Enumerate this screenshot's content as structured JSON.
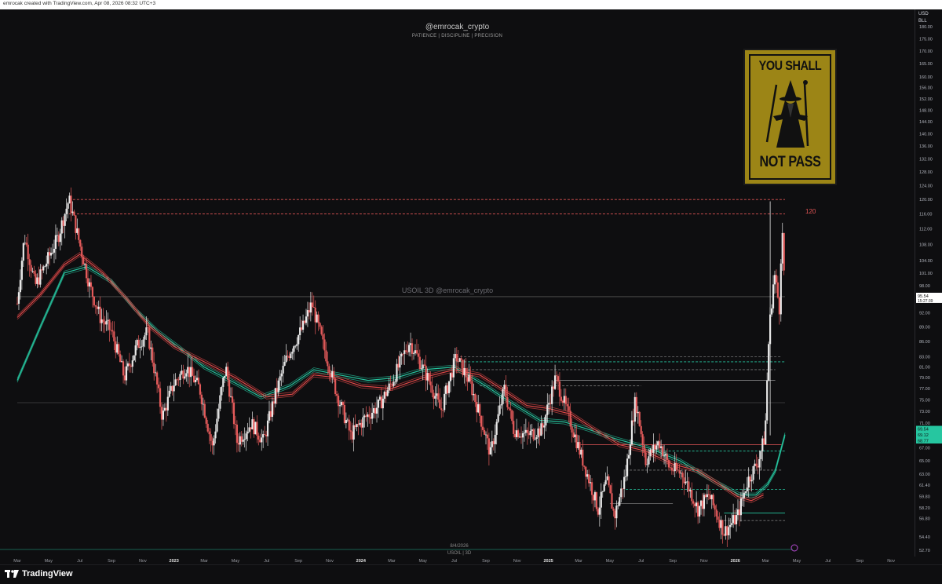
{
  "header": {
    "created_text": "emrocak created with TradingView.com, Apr 08, 2026 08:32 UTC+3",
    "handle": "@emrocak_crypto",
    "subtitle": "PATIENCE  |  DISCIPLINE  |  PRECISION"
  },
  "watermark": "USOIL 3D  @emrocak_crypto",
  "poster": {
    "line1": "YOU SHALL",
    "line2": "NOT PASS",
    "icon": "wizard-silhouette-icon"
  },
  "price_axis": {
    "currency": "USD",
    "unit": "BLL"
  },
  "level_label": "120",
  "bottom_note": {
    "date": "8/4/2026",
    "symbol": "USOIL | 3D"
  },
  "footer": {
    "brand": "TradingView",
    "logo": "tradingview-logo-icon"
  },
  "colors": {
    "up": "#e8e8e8",
    "down": "#e35a5a",
    "ema_fast": "#e04848",
    "ema_slow": "#26c6a0",
    "level": "#e25555",
    "background": "#0e0e10"
  },
  "chart_data": {
    "type": "candlestick",
    "symbol": "USOIL",
    "timeframe": "3D",
    "ylim": [
      52.7,
      182
    ],
    "x_range": [
      "2022-03-01",
      "2026-11-30"
    ],
    "y_ticks": [
      52.7,
      54.4,
      56.8,
      58.2,
      59.8,
      61.4,
      63.0,
      65.0,
      67.0,
      69.0,
      71.0,
      73.0,
      75.0,
      77.0,
      79.0,
      81.0,
      83.0,
      86.0,
      89.0,
      92.0,
      95.0,
      98.0,
      101.0,
      104.0,
      108.0,
      112.0,
      116.0,
      120.0,
      124.0,
      128.0,
      132.0,
      136.0,
      140.0,
      144.0,
      148.0,
      152.0,
      156.0,
      160.0,
      165.0,
      170.0,
      175.0,
      180.0
    ],
    "x_ticks": [
      {
        "label": "Mar",
        "date": "2022-03-01"
      },
      {
        "label": "May",
        "date": "2022-05-01"
      },
      {
        "label": "Jul",
        "date": "2022-07-01"
      },
      {
        "label": "Sep",
        "date": "2022-09-01"
      },
      {
        "label": "Nov",
        "date": "2022-11-01"
      },
      {
        "label": "2023",
        "date": "2023-01-01"
      },
      {
        "label": "Mar",
        "date": "2023-03-01"
      },
      {
        "label": "May",
        "date": "2023-05-01"
      },
      {
        "label": "Jul",
        "date": "2023-07-01"
      },
      {
        "label": "Sep",
        "date": "2023-09-01"
      },
      {
        "label": "Nov",
        "date": "2023-11-01"
      },
      {
        "label": "2024",
        "date": "2024-01-01"
      },
      {
        "label": "Mar",
        "date": "2024-03-01"
      },
      {
        "label": "May",
        "date": "2024-05-01"
      },
      {
        "label": "Jul",
        "date": "2024-07-01"
      },
      {
        "label": "Sep",
        "date": "2024-09-01"
      },
      {
        "label": "Nov",
        "date": "2024-11-01"
      },
      {
        "label": "2025",
        "date": "2025-01-01"
      },
      {
        "label": "Mar",
        "date": "2025-03-01"
      },
      {
        "label": "May",
        "date": "2025-05-01"
      },
      {
        "label": "Jul",
        "date": "2025-07-01"
      },
      {
        "label": "Sep",
        "date": "2025-09-01"
      },
      {
        "label": "Nov",
        "date": "2025-11-01"
      },
      {
        "label": "2026",
        "date": "2026-01-01"
      },
      {
        "label": "Mar",
        "date": "2026-03-01"
      },
      {
        "label": "May",
        "date": "2026-05-01"
      },
      {
        "label": "Jul",
        "date": "2026-07-01"
      },
      {
        "label": "Sep",
        "date": "2026-09-01"
      },
      {
        "label": "Nov",
        "date": "2026-11-01"
      }
    ],
    "price_path": [
      [
        "2022-03-01",
        94
      ],
      [
        "2022-03-15",
        110
      ],
      [
        "2022-04-05",
        98
      ],
      [
        "2022-04-25",
        103
      ],
      [
        "2022-05-20",
        110
      ],
      [
        "2022-06-10",
        120
      ],
      [
        "2022-07-01",
        108
      ],
      [
        "2022-07-20",
        98
      ],
      [
        "2022-08-10",
        91
      ],
      [
        "2022-09-01",
        88
      ],
      [
        "2022-09-26",
        79
      ],
      [
        "2022-10-20",
        85
      ],
      [
        "2022-11-10",
        88
      ],
      [
        "2022-12-09",
        72
      ],
      [
        "2023-01-01",
        78
      ],
      [
        "2023-01-25",
        81
      ],
      [
        "2023-02-20",
        77
      ],
      [
        "2023-03-17",
        67
      ],
      [
        "2023-04-12",
        81
      ],
      [
        "2023-05-04",
        68
      ],
      [
        "2023-06-01",
        71
      ],
      [
        "2023-06-25",
        68
      ],
      [
        "2023-07-15",
        75
      ],
      [
        "2023-08-10",
        83
      ],
      [
        "2023-09-10",
        89
      ],
      [
        "2023-09-27",
        94
      ],
      [
        "2023-10-20",
        85
      ],
      [
        "2023-11-15",
        76
      ],
      [
        "2023-12-12",
        69
      ],
      [
        "2024-01-10",
        72
      ],
      [
        "2024-02-05",
        74
      ],
      [
        "2024-03-01",
        78
      ],
      [
        "2024-04-05",
        86
      ],
      [
        "2024-04-25",
        82
      ],
      [
        "2024-05-20",
        77
      ],
      [
        "2024-06-05",
        73
      ],
      [
        "2024-07-05",
        83
      ],
      [
        "2024-08-01",
        78
      ],
      [
        "2024-09-10",
        66
      ],
      [
        "2024-10-07",
        77
      ],
      [
        "2024-10-25",
        70
      ],
      [
        "2024-11-20",
        69
      ],
      [
        "2024-12-20",
        70
      ],
      [
        "2025-01-15",
        79
      ],
      [
        "2025-02-10",
        72
      ],
      [
        "2025-03-05",
        66
      ],
      [
        "2025-04-08",
        58
      ],
      [
        "2025-04-25",
        62
      ],
      [
        "2025-05-10",
        57
      ],
      [
        "2025-06-01",
        63
      ],
      [
        "2025-06-20",
        75
      ],
      [
        "2025-07-10",
        65
      ],
      [
        "2025-08-05",
        68
      ],
      [
        "2025-08-25",
        64
      ],
      [
        "2025-09-20",
        63
      ],
      [
        "2025-10-20",
        58
      ],
      [
        "2025-11-10",
        60
      ],
      [
        "2025-12-10",
        55
      ],
      [
        "2026-01-05",
        57
      ],
      [
        "2026-01-25",
        62
      ],
      [
        "2026-02-15",
        65
      ],
      [
        "2026-02-28",
        69
      ],
      [
        "2026-03-08",
        88
      ],
      [
        "2026-03-18",
        101
      ],
      [
        "2026-03-28",
        93
      ],
      [
        "2026-04-02",
        113
      ],
      [
        "2026-04-08",
        95.54
      ]
    ],
    "ema_fast": [
      [
        "2022-03-01",
        91
      ],
      [
        "2022-04-15",
        96
      ],
      [
        "2022-06-01",
        103
      ],
      [
        "2022-07-01",
        105.5
      ],
      [
        "2022-08-15",
        101
      ],
      [
        "2022-10-01",
        95
      ],
      [
        "2022-11-15",
        89
      ],
      [
        "2023-01-01",
        85
      ],
      [
        "2023-03-01",
        82
      ],
      [
        "2023-05-01",
        79
      ],
      [
        "2023-07-01",
        75.5
      ],
      [
        "2023-08-20",
        76
      ],
      [
        "2023-10-01",
        79.5
      ],
      [
        "2023-11-15",
        79
      ],
      [
        "2024-01-01",
        77.5
      ],
      [
        "2024-03-01",
        77
      ],
      [
        "2024-05-01",
        79
      ],
      [
        "2024-07-01",
        80.5
      ],
      [
        "2024-08-20",
        79.5
      ],
      [
        "2024-10-01",
        77
      ],
      [
        "2024-11-20",
        74
      ],
      [
        "2025-01-01",
        73.5
      ],
      [
        "2025-02-15",
        72.5
      ],
      [
        "2025-04-01",
        70
      ],
      [
        "2025-05-20",
        67.5
      ],
      [
        "2025-07-10",
        66.5
      ],
      [
        "2025-09-01",
        64.5
      ],
      [
        "2025-10-20",
        63.5
      ],
      [
        "2025-12-01",
        61.5
      ],
      [
        "2026-01-05",
        59.8
      ],
      [
        "2026-02-01",
        59.2
      ],
      [
        "2026-02-25",
        60
      ]
    ],
    "ema_slow": [
      [
        "2022-03-01",
        78.5
      ],
      [
        "2022-04-15",
        89
      ],
      [
        "2022-06-01",
        101
      ],
      [
        "2022-07-15",
        102.5
      ],
      [
        "2022-09-01",
        99
      ],
      [
        "2022-10-15",
        93
      ],
      [
        "2022-12-01",
        88
      ],
      [
        "2023-01-15",
        84.5
      ],
      [
        "2023-03-01",
        81
      ],
      [
        "2023-05-01",
        78
      ],
      [
        "2023-06-20",
        75.5
      ],
      [
        "2023-08-15",
        77.5
      ],
      [
        "2023-10-01",
        80.5
      ],
      [
        "2023-11-20",
        79.5
      ],
      [
        "2024-01-15",
        78.5
      ],
      [
        "2024-03-10",
        79
      ],
      [
        "2024-05-01",
        80.5
      ],
      [
        "2024-07-01",
        81
      ],
      [
        "2024-09-01",
        77.5
      ],
      [
        "2024-10-20",
        74.5
      ],
      [
        "2024-12-15",
        71.5
      ],
      [
        "2025-02-01",
        71.2
      ],
      [
        "2025-03-20",
        70
      ],
      [
        "2025-05-10",
        68.5
      ],
      [
        "2025-07-15",
        67
      ],
      [
        "2025-09-15",
        65
      ],
      [
        "2025-11-20",
        62
      ],
      [
        "2026-01-10",
        60
      ],
      [
        "2026-02-10",
        60
      ],
      [
        "2026-03-05",
        61.5
      ],
      [
        "2026-03-20",
        63.5
      ],
      [
        "2026-04-08",
        69.12
      ]
    ],
    "levels": [
      {
        "value": 120,
        "style": "dashed",
        "color": "#e25555",
        "from": "2022-06-10",
        "to": "2026-04-08"
      },
      {
        "value": 116,
        "style": "dashed",
        "color": "#e25555",
        "from": "2022-06-10",
        "to": "2026-04-08"
      },
      {
        "value": 95.54,
        "style": "solid",
        "color": "#555555",
        "from": "2022-03-01",
        "to": "2026-04-08"
      },
      {
        "value": 74.5,
        "style": "solid",
        "color": "#444444",
        "from": "2022-03-01",
        "to": "2026-04-08"
      },
      {
        "value": 83,
        "style": "dashed",
        "color": "#777777",
        "from": "2024-07-05",
        "to": "2026-04-01"
      },
      {
        "value": 82,
        "style": "dashed",
        "color": "#26c6a0",
        "from": "2024-07-05",
        "to": "2026-04-08"
      },
      {
        "value": 80.5,
        "style": "dashed",
        "color": "#777777",
        "from": "2024-07-05",
        "to": "2026-03-20"
      },
      {
        "value": 78.5,
        "style": "solid",
        "color": "#999999",
        "from": "2025-01-15",
        "to": "2026-03-20"
      },
      {
        "value": 77.5,
        "style": "dashed",
        "color": "#777777",
        "from": "2024-08-20",
        "to": "2025-07-01"
      },
      {
        "value": 67.5,
        "style": "solid",
        "color": "#e25555",
        "from": "2025-03-05",
        "to": "2026-04-01"
      },
      {
        "value": 66.5,
        "style": "dashed",
        "color": "#26c6a0",
        "from": "2025-07-01",
        "to": "2026-04-08"
      },
      {
        "value": 63.6,
        "style": "dashed",
        "color": "#777777",
        "from": "2025-06-01",
        "to": "2026-04-01"
      },
      {
        "value": 60.8,
        "style": "dashed",
        "color": "#26c6a0",
        "from": "2025-06-01",
        "to": "2026-04-08"
      },
      {
        "value": 57.5,
        "style": "solid",
        "color": "#26c6a0",
        "from": "2025-12-10",
        "to": "2026-04-08"
      },
      {
        "value": 56.5,
        "style": "dashed",
        "color": "#777777",
        "from": "2025-12-10",
        "to": "2026-04-08"
      },
      {
        "value": 58.8,
        "style": "solid",
        "color": "#777777",
        "from": "2025-05-01",
        "to": "2025-09-01"
      }
    ],
    "price_labels": [
      {
        "value": 95.54,
        "text": "95.54",
        "sub": "15:27:39",
        "style": "current"
      },
      {
        "value": 69.54,
        "text": "69.54",
        "style": "green"
      },
      {
        "value": 69.12,
        "text": "69.12",
        "style": "green"
      },
      {
        "value": 68.77,
        "text": "68.77",
        "style": "green"
      }
    ]
  }
}
